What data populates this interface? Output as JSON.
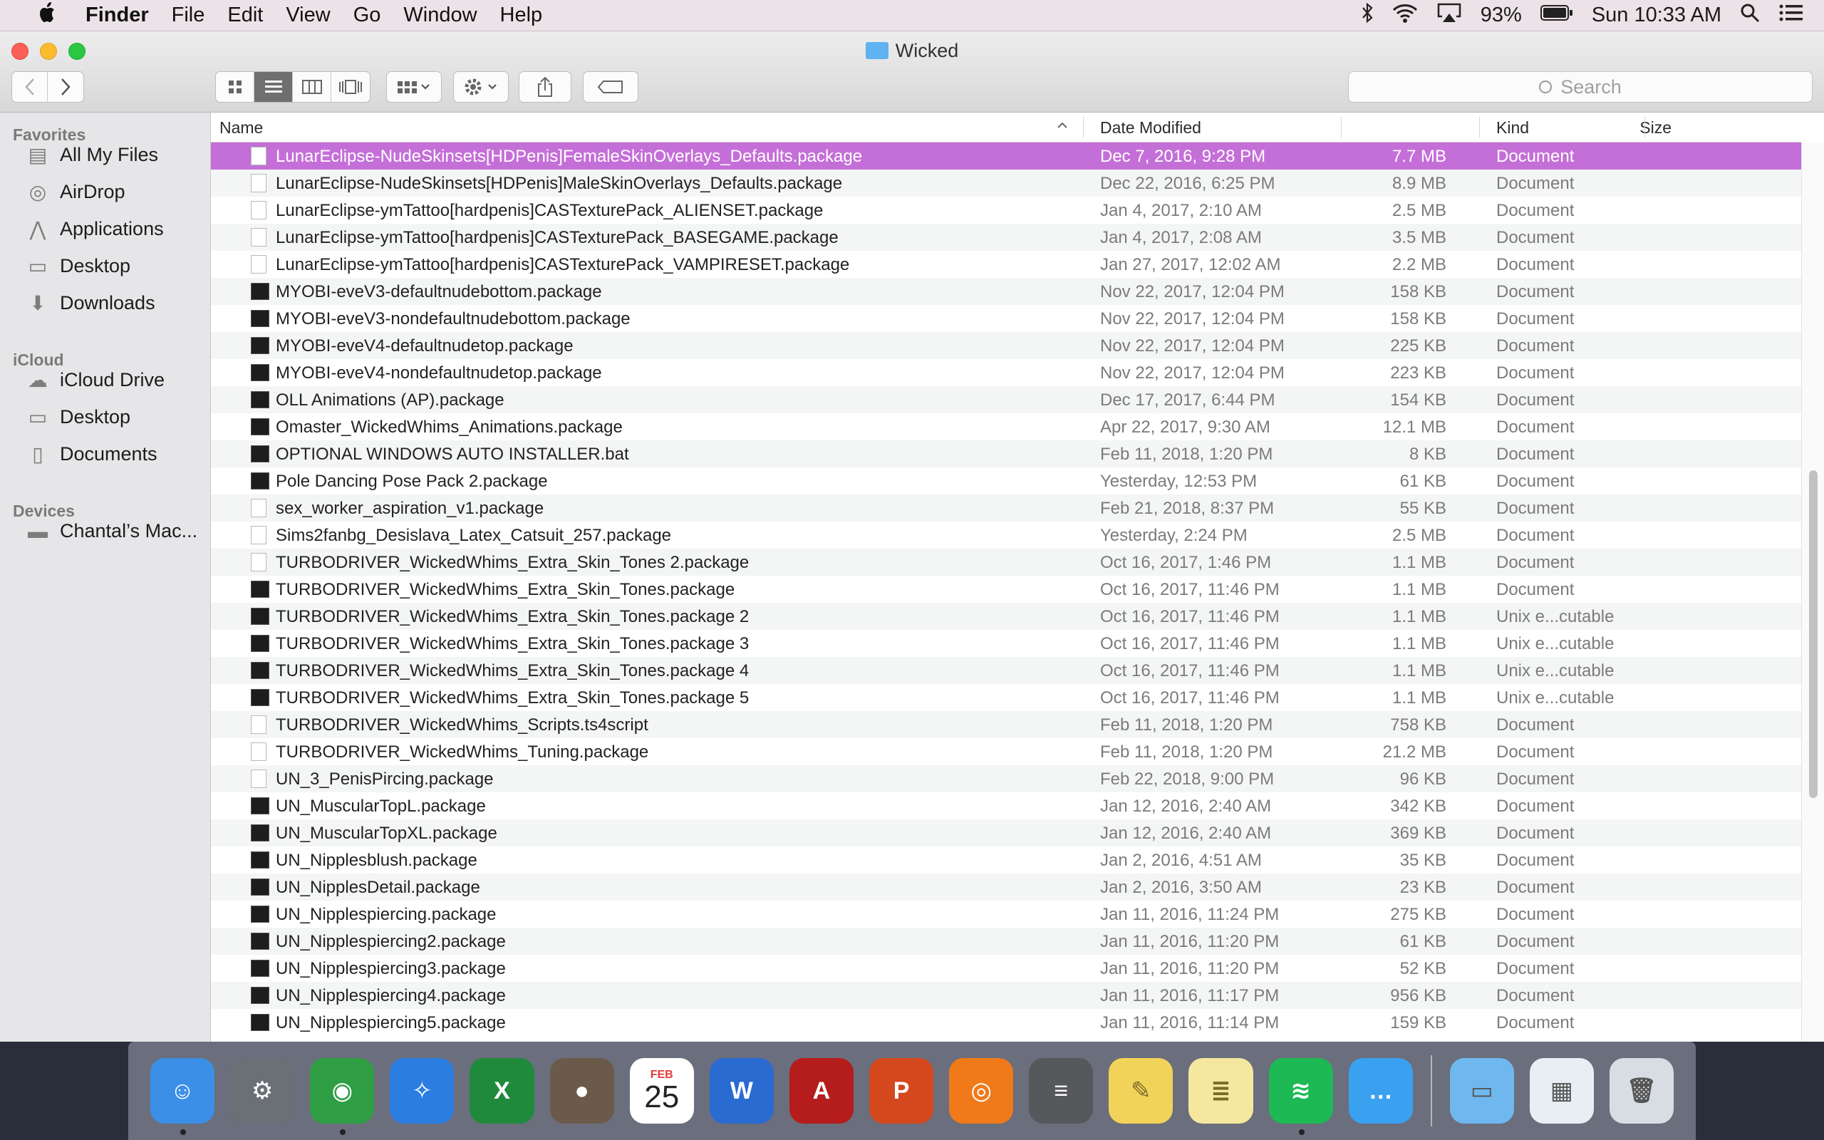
{
  "menubar": {
    "app_name": "Finder",
    "menus": [
      "File",
      "Edit",
      "View",
      "Go",
      "Window",
      "Help"
    ],
    "battery": "93%",
    "clock": "Sun 10:33 AM"
  },
  "window": {
    "title": "Wicked",
    "search_placeholder": "Search"
  },
  "sidebar": {
    "favorites_header": "Favorites",
    "favorites": [
      "All My Files",
      "AirDrop",
      "Applications",
      "Desktop",
      "Downloads"
    ],
    "icloud_header": "iCloud",
    "icloud": [
      "iCloud Drive",
      "Desktop",
      "Documents"
    ],
    "devices_header": "Devices",
    "devices": [
      "Chantal’s Mac..."
    ]
  },
  "columns": {
    "name": "Name",
    "date": "Date Modified",
    "size": "Size",
    "kind": "Kind"
  },
  "files": [
    {
      "name": "LunarEclipse-NudeSkinsets[HDPenis]FemaleSkinOverlays_Defaults.package",
      "date": "Dec 7, 2016, 9:28 PM",
      "size": "7.7 MB",
      "kind": "Document",
      "icon": "doc",
      "selected": true
    },
    {
      "name": "LunarEclipse-NudeSkinsets[HDPenis]MaleSkinOverlays_Defaults.package",
      "date": "Dec 22, 2016, 6:25 PM",
      "size": "8.9 MB",
      "kind": "Document",
      "icon": "doc"
    },
    {
      "name": "LunarEclipse-ymTattoo[hardpenis]CASTexturePack_ALIENSET.package",
      "date": "Jan 4, 2017, 2:10 AM",
      "size": "2.5 MB",
      "kind": "Document",
      "icon": "doc"
    },
    {
      "name": "LunarEclipse-ymTattoo[hardpenis]CASTexturePack_BASEGAME.package",
      "date": "Jan 4, 2017, 2:08 AM",
      "size": "3.5 MB",
      "kind": "Document",
      "icon": "doc"
    },
    {
      "name": "LunarEclipse-ymTattoo[hardpenis]CASTexturePack_VAMPIRESET.package",
      "date": "Jan 27, 2017, 12:02 AM",
      "size": "2.2 MB",
      "kind": "Document",
      "icon": "doc"
    },
    {
      "name": "MYOBI-eveV3-defaultnudebottom.package",
      "date": "Nov 22, 2017, 12:04 PM",
      "size": "158 KB",
      "kind": "Document",
      "icon": "exe"
    },
    {
      "name": "MYOBI-eveV3-nondefaultnudebottom.package",
      "date": "Nov 22, 2017, 12:04 PM",
      "size": "158 KB",
      "kind": "Document",
      "icon": "exe"
    },
    {
      "name": "MYOBI-eveV4-defaultnudetop.package",
      "date": "Nov 22, 2017, 12:04 PM",
      "size": "225 KB",
      "kind": "Document",
      "icon": "exe"
    },
    {
      "name": "MYOBI-eveV4-nondefaultnudetop.package",
      "date": "Nov 22, 2017, 12:04 PM",
      "size": "223 KB",
      "kind": "Document",
      "icon": "exe"
    },
    {
      "name": "OLL Animations (AP).package",
      "date": "Dec 17, 2017, 6:44 PM",
      "size": "154 KB",
      "kind": "Document",
      "icon": "exe"
    },
    {
      "name": "Omaster_WickedWhims_Animations.package",
      "date": "Apr 22, 2017, 9:30 AM",
      "size": "12.1 MB",
      "kind": "Document",
      "icon": "exe"
    },
    {
      "name": "OPTIONAL WINDOWS AUTO INSTALLER.bat",
      "date": "Feb 11, 2018, 1:20 PM",
      "size": "8 KB",
      "kind": "Document",
      "icon": "exe"
    },
    {
      "name": "Pole Dancing Pose Pack 2.package",
      "date": "Yesterday, 12:53 PM",
      "size": "61 KB",
      "kind": "Document",
      "icon": "exe"
    },
    {
      "name": "sex_worker_aspiration_v1.package",
      "date": "Feb 21, 2018, 8:37 PM",
      "size": "55 KB",
      "kind": "Document",
      "icon": "doc"
    },
    {
      "name": "Sims2fanbg_Desislava_Latex_Catsuit_257.package",
      "date": "Yesterday, 2:24 PM",
      "size": "2.5 MB",
      "kind": "Document",
      "icon": "doc"
    },
    {
      "name": "TURBODRIVER_WickedWhims_Extra_Skin_Tones 2.package",
      "date": "Oct 16, 2017, 1:46 PM",
      "size": "1.1 MB",
      "kind": "Document",
      "icon": "doc"
    },
    {
      "name": "TURBODRIVER_WickedWhims_Extra_Skin_Tones.package",
      "date": "Oct 16, 2017, 11:46 PM",
      "size": "1.1 MB",
      "kind": "Document",
      "icon": "exe"
    },
    {
      "name": "TURBODRIVER_WickedWhims_Extra_Skin_Tones.package 2",
      "date": "Oct 16, 2017, 11:46 PM",
      "size": "1.1 MB",
      "kind": "Unix e...cutable",
      "icon": "exe"
    },
    {
      "name": "TURBODRIVER_WickedWhims_Extra_Skin_Tones.package 3",
      "date": "Oct 16, 2017, 11:46 PM",
      "size": "1.1 MB",
      "kind": "Unix e...cutable",
      "icon": "exe"
    },
    {
      "name": "TURBODRIVER_WickedWhims_Extra_Skin_Tones.package 4",
      "date": "Oct 16, 2017, 11:46 PM",
      "size": "1.1 MB",
      "kind": "Unix e...cutable",
      "icon": "exe"
    },
    {
      "name": "TURBODRIVER_WickedWhims_Extra_Skin_Tones.package 5",
      "date": "Oct 16, 2017, 11:46 PM",
      "size": "1.1 MB",
      "kind": "Unix e...cutable",
      "icon": "exe"
    },
    {
      "name": "TURBODRIVER_WickedWhims_Scripts.ts4script",
      "date": "Feb 11, 2018, 1:20 PM",
      "size": "758 KB",
      "kind": "Document",
      "icon": "doc"
    },
    {
      "name": "TURBODRIVER_WickedWhims_Tuning.package",
      "date": "Feb 11, 2018, 1:20 PM",
      "size": "21.2 MB",
      "kind": "Document",
      "icon": "doc"
    },
    {
      "name": "UN_3_PenisPircing.package",
      "date": "Feb 22, 2018, 9:00 PM",
      "size": "96 KB",
      "kind": "Document",
      "icon": "doc"
    },
    {
      "name": "UN_MuscularTopL.package",
      "date": "Jan 12, 2016, 2:40 AM",
      "size": "342 KB",
      "kind": "Document",
      "icon": "exe"
    },
    {
      "name": "UN_MuscularTopXL.package",
      "date": "Jan 12, 2016, 2:40 AM",
      "size": "369 KB",
      "kind": "Document",
      "icon": "exe"
    },
    {
      "name": "UN_Nipplesblush.package",
      "date": "Jan 2, 2016, 4:51 AM",
      "size": "35 KB",
      "kind": "Document",
      "icon": "exe"
    },
    {
      "name": "UN_NipplesDetail.package",
      "date": "Jan 2, 2016, 3:50 AM",
      "size": "23 KB",
      "kind": "Document",
      "icon": "exe"
    },
    {
      "name": "UN_Nipplespiercing.package",
      "date": "Jan 11, 2016, 11:24 PM",
      "size": "275 KB",
      "kind": "Document",
      "icon": "exe"
    },
    {
      "name": "UN_Nipplespiercing2.package",
      "date": "Jan 11, 2016, 11:20 PM",
      "size": "61 KB",
      "kind": "Document",
      "icon": "exe"
    },
    {
      "name": "UN_Nipplespiercing3.package",
      "date": "Jan 11, 2016, 11:20 PM",
      "size": "52 KB",
      "kind": "Document",
      "icon": "exe"
    },
    {
      "name": "UN_Nipplespiercing4.package",
      "date": "Jan 11, 2016, 11:17 PM",
      "size": "956 KB",
      "kind": "Document",
      "icon": "exe"
    },
    {
      "name": "UN_Nipplespiercing5.package",
      "date": "Jan 11, 2016, 11:14 PM",
      "size": "159 KB",
      "kind": "Document",
      "icon": "exe"
    }
  ],
  "dock": {
    "calendar_month": "FEB",
    "calendar_day": "25",
    "apps": [
      {
        "name": "Finder",
        "glyph": "☺",
        "color": "#3b8fe6",
        "running": true
      },
      {
        "name": "System Preferences",
        "glyph": "⚙",
        "color": "#6b6f76"
      },
      {
        "name": "Google Chrome",
        "glyph": "◉",
        "color": "#2f9e44",
        "running": true
      },
      {
        "name": "Safari",
        "glyph": "✧",
        "color": "#2b7de0"
      },
      {
        "name": "Excel",
        "glyph": "X",
        "color": "#1f8a3c"
      },
      {
        "name": "Steam",
        "glyph": "●",
        "color": "#6b5a4a"
      },
      {
        "name": "Calendar",
        "glyph": "",
        "color": "#ffffff"
      },
      {
        "name": "Word",
        "glyph": "W",
        "color": "#2a6bd1"
      },
      {
        "name": "Acrobat",
        "glyph": "A",
        "color": "#b51c1c"
      },
      {
        "name": "PowerPoint",
        "glyph": "P",
        "color": "#d4481e"
      },
      {
        "name": "Origin",
        "glyph": "◎",
        "color": "#f07a1a"
      },
      {
        "name": "Calculator",
        "glyph": "≡",
        "color": "#57585c"
      },
      {
        "name": "Stickies",
        "glyph": "✎",
        "color": "#f2d35a"
      },
      {
        "name": "Notes",
        "glyph": "≣",
        "color": "#f5e79e"
      },
      {
        "name": "Spotify",
        "glyph": "≋",
        "color": "#1db954",
        "running": true
      },
      {
        "name": "Messages",
        "glyph": "…",
        "color": "#3aa0f0"
      }
    ],
    "stack": [
      {
        "name": "Downloads folder",
        "glyph": "▭",
        "color": "#6fb8ef"
      },
      {
        "name": "Chrome app window",
        "glyph": "▦",
        "color": "#e9eef5"
      },
      {
        "name": "Trash",
        "glyph": "🗑",
        "color": "#d8dde3"
      }
    ]
  }
}
